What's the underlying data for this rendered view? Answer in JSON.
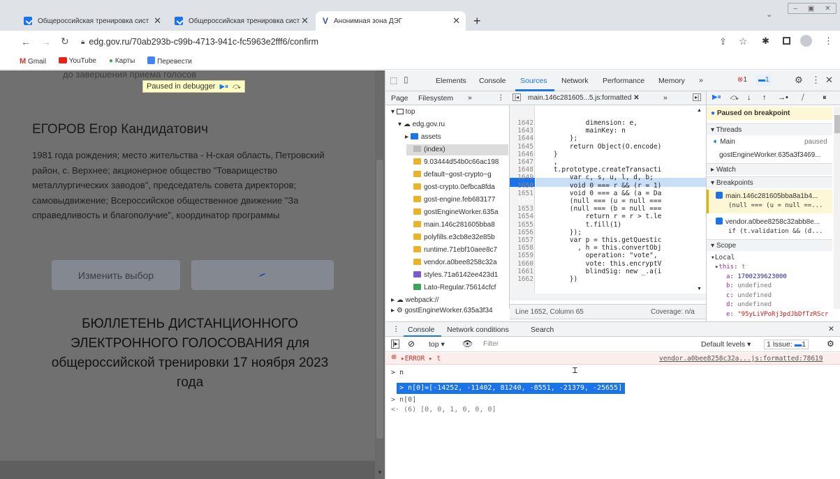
{
  "browser": {
    "tabs": [
      {
        "title": "Общероссийская тренировка сист"
      },
      {
        "title": "Общероссийская тренировка сист"
      },
      {
        "title": "Анонимная зона ДЭГ"
      }
    ],
    "url": "edg.gov.ru/70ab293b-c99b-4713-941c-fc5963e2fff6/confirm",
    "bookmarks": [
      "Gmail",
      "YouTube",
      "Карты",
      "Перевести"
    ]
  },
  "page": {
    "top_cut_text": "до завершения приема голосов",
    "debugger_label": "Paused in debugger",
    "candidate_name": "ЕГОРОВ Егор Кандидатович",
    "candidate_desc": "1981 года рождения; место жительства - Н-ская область, Петровский район, с. Верхнее; акционерное общество \"Товарищество металлургических заводов\", председатель совета директоров; самовыдвижение; Всероссийское общественное движение \"За справедливость и благополучие\", координатор программы",
    "change_button": "Изменить выбор",
    "ballot_title": "БЮЛЛЕТЕНЬ ДИСТАНЦИОННОГО ЭЛЕКТРОННОГО ГОЛОСОВАНИЯ для общероссийской тренировки 17 ноября 2023 года"
  },
  "devtools": {
    "tabs": [
      "Elements",
      "Console",
      "Sources",
      "Network",
      "Performance",
      "Memory"
    ],
    "active_tab": "Sources",
    "error_count": "1",
    "msg_count": "1",
    "nav": {
      "tabs": [
        "Page",
        "Filesystem"
      ],
      "tree": [
        "top",
        "edg.gov.ru",
        "assets",
        "(index)",
        "9.03444d54b0c66ac198",
        "default~gost-crypto~g",
        "gost-crypto.0efbca8fda",
        "gost-engine.feb683177",
        "gostEngineWorker.635a",
        "main.146c281605bba8",
        "polyfills.e3cb8e32e85b",
        "runtime.71ebf10aee8c7",
        "vendor.a0bee8258c32a",
        "styles.71a6142ee423d1",
        "Lato-Regular.75614cfcf",
        "webpack://",
        "gostEngineWorker.635a3f34"
      ]
    },
    "editor": {
      "file_tab": "main.146c281605...5.js:formatted",
      "lines": [
        {
          "n": "1642",
          "code": "            dimension: e,"
        },
        {
          "n": "1643",
          "code": "            mainKey: n"
        },
        {
          "n": "1644",
          "code": "        };"
        },
        {
          "n": "1645",
          "code": "        return Object(O.encode)"
        },
        {
          "n": "1646",
          "code": "    }"
        },
        {
          "n": "1647",
          "code": "    ,"
        },
        {
          "n": "1648",
          "code": "    t.prototype.createTransacti"
        },
        {
          "n": "1649",
          "code": "        var c, s, u, l, d, b;"
        },
        {
          "n": "1650",
          "code": "        void 0 === r && (r = 1)"
        },
        {
          "n": "1651",
          "code": "        void 0 === a && (a = Da"
        },
        {
          "n": "1652",
          "code": "        (null === (u = null ==="
        },
        {
          "n": "1653",
          "code": "        (null === (b = null ==="
        },
        {
          "n": "1654",
          "code": "            return r = r > t.le"
        },
        {
          "n": "1655",
          "code": "            t.fill(1)"
        },
        {
          "n": "1656",
          "code": "        });"
        },
        {
          "n": "1657",
          "code": "        var p = this.getQuestic"
        },
        {
          "n": "1658",
          "code": "          , h = this.convertObj"
        },
        {
          "n": "1659",
          "code": "            operation: \"vote\","
        },
        {
          "n": "1660",
          "code": "            vote: this.encryptV"
        },
        {
          "n": "1661",
          "code": "            blindSig: new _.a(i"
        },
        {
          "n": "1662",
          "code": "        })"
        }
      ],
      "status_pos": "Line 1652, Column 65",
      "status_cov": "Coverage: n/a"
    },
    "debugger": {
      "paused": "Paused on breakpoint",
      "threads_label": "Threads",
      "thread_main": "Main",
      "thread_main_status": "paused",
      "thread_worker": "gostEngineWorker.635a3f3469...",
      "watch_label": "Watch",
      "breakpoints_label": "Breakpoints",
      "bp1_file": "main.146c281605bba8a1b4...",
      "bp1_code": "(null === (u = null ==...",
      "bp2_file": "vendor.a0bee8258c32abb8e...",
      "bp2_code": "if (t.validation && (d...",
      "scope_label": "Scope",
      "local_label": "Local",
      "scope_vars": [
        {
          "k": "this",
          "v": "t"
        },
        {
          "k": "a",
          "v": "1700239623000"
        },
        {
          "k": "b",
          "v": "undefined"
        },
        {
          "k": "c",
          "v": "undefined"
        },
        {
          "k": "d",
          "v": "undefined"
        },
        {
          "k": "e",
          "v": "\"95yLiVPoRj3pdJbDfTzRScr"
        }
      ]
    },
    "drawer": {
      "tabs": [
        "Console",
        "Network conditions",
        "Search"
      ],
      "context": "top",
      "filter_placeholder": "Filter",
      "levels": "Default levels",
      "issues": "1 Issue:",
      "issue_count": "1",
      "error_line": "ERROR ▸ t",
      "error_src": "vendor.a0bee8258c32a...js:formatted:78619",
      "lines": [
        "n",
        "n[0]=[-14252, -11402, 81240, -8551, -21379, -25655]",
        "n[0]",
        "(6) [0, 0, 1, 0, 0, 0]"
      ]
    }
  }
}
